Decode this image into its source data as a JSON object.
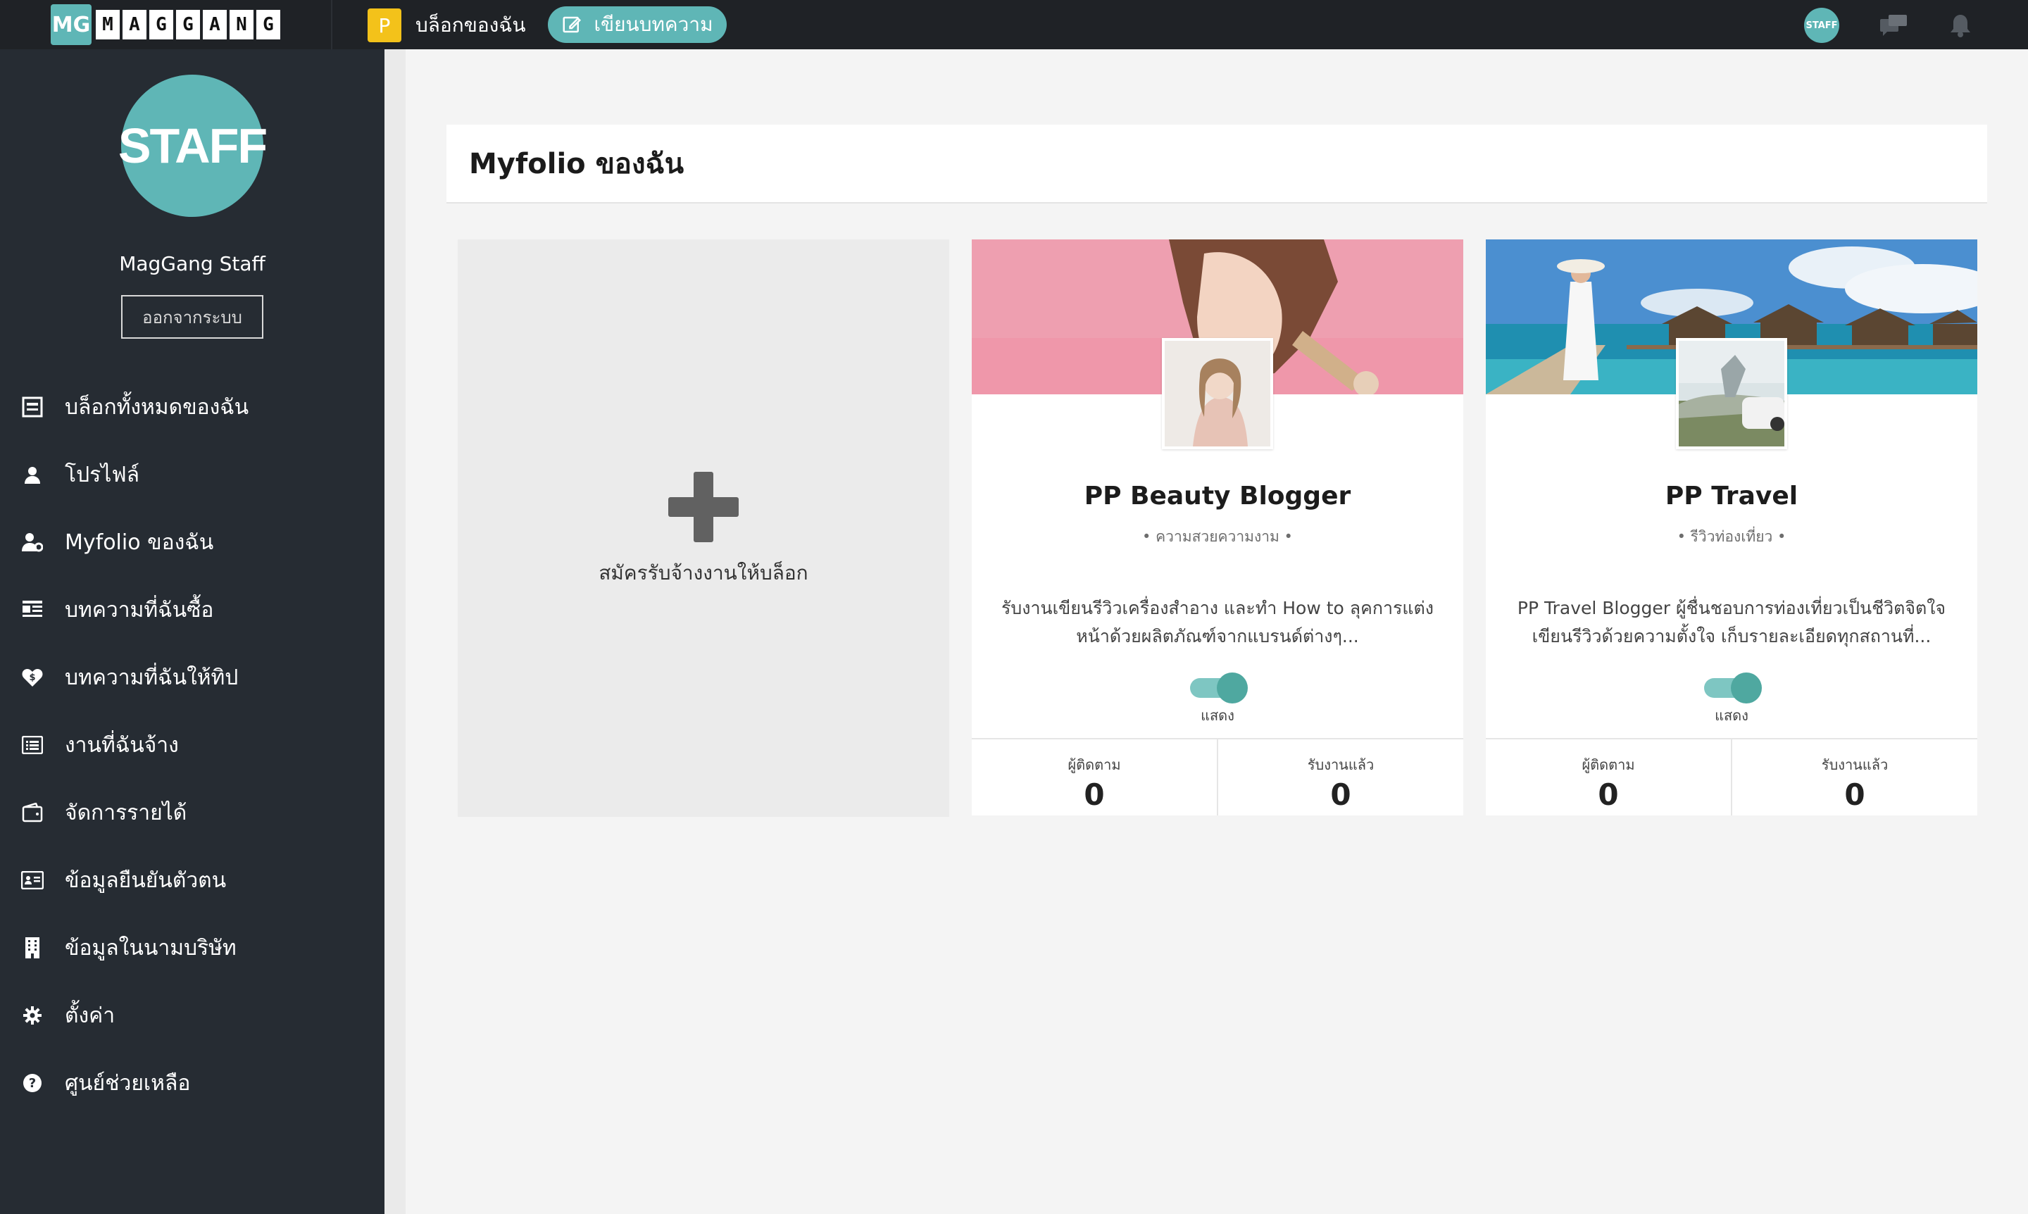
{
  "topbar": {
    "logo_mark": "MG",
    "logo_letters": [
      "M",
      "A",
      "G",
      "G",
      "A",
      "N",
      "G"
    ],
    "blog_badge": "P",
    "blog_label": "บล็อกของฉัน",
    "write_label": "เขียนบทความ",
    "avatar_text": "STAFF"
  },
  "sidebar": {
    "avatar_text": "STAFF",
    "user_name": "MagGang Staff",
    "logout_label": "ออกจากระบบ",
    "items": [
      {
        "label": "บล็อกทั้งหมดของฉัน",
        "icon": "blog-list-icon"
      },
      {
        "label": "โปรไฟล์",
        "icon": "user-icon"
      },
      {
        "label": "Myfolio ของฉัน",
        "icon": "user-gear-icon"
      },
      {
        "label": "บทความที่ฉันซื้อ",
        "icon": "article-icon"
      },
      {
        "label": "บทความที่ฉันให้ทิป",
        "icon": "heart-dollar-icon"
      },
      {
        "label": "งานที่ฉันจ้าง",
        "icon": "list-icon"
      },
      {
        "label": "จัดการรายได้",
        "icon": "wallet-icon"
      },
      {
        "label": "ข้อมูลยืนยันตัวตน",
        "icon": "id-card-icon"
      },
      {
        "label": "ข้อมูลในนามบริษัท",
        "icon": "building-icon"
      },
      {
        "label": "ตั้งค่า",
        "icon": "gear-icon"
      },
      {
        "label": "ศูนย์ช่วยเหลือ",
        "icon": "help-icon"
      }
    ]
  },
  "main": {
    "title": "Myfolio ของฉัน",
    "add_card_label": "สมัครรับจ้างงานให้บล็อก",
    "cards": [
      {
        "title": "PP Beauty Blogger",
        "category": "• ความสวยความงาม •",
        "description": "รับงานเขียนรีวิวเครื่องสำอาง และทำ How to ลุคการแต่งหน้าด้วยผลิตภัณฑ์จากแบรนด์ต่างๆ...",
        "toggle_label": "แสดง",
        "toggle_on": true,
        "followers_label": "ผู้ติดตาม",
        "followers": "0",
        "jobs_label": "รับงานแล้ว",
        "jobs": "0"
      },
      {
        "title": "PP Travel",
        "category": "• รีวิวท่องเที่ยว •",
        "description": "PP Travel Blogger ผู้ชื่นชอบการท่องเที่ยวเป็นชีวิตจิตใจ เขียนรีวิวด้วยความตั้งใจ เก็บรายละเอียดทุกสถานที่...",
        "toggle_label": "แสดง",
        "toggle_on": true,
        "followers_label": "ผู้ติดตาม",
        "followers": "0",
        "jobs_label": "รับงานแล้ว",
        "jobs": "0"
      }
    ]
  },
  "colors": {
    "accent": "#5fb6b6",
    "topbar": "#1f2226",
    "sidebar": "#262c33",
    "blog_badge": "#f3c21a"
  }
}
